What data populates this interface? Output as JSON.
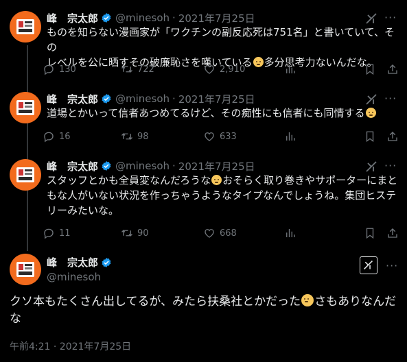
{
  "author": {
    "name": "峰　宗太郎",
    "handle": "@minesoh"
  },
  "replies": [
    {
      "date": "2021年7月25日",
      "lines": [
        "ものを知らない漫画家が「ワクチンの副反応死は751名」と書いていて、その",
        "レベルを公に晒すその破廉恥さを嘆いている|多分思考力ないんだな。"
      ],
      "stats": {
        "replies": "130",
        "retweets": "722",
        "likes": "2,910"
      }
    },
    {
      "date": "2021年7月25日",
      "lines": [
        "道場とかいって信者あつめてるけど、その痴性にも信者にも同情する|"
      ],
      "stats": {
        "replies": "16",
        "retweets": "98",
        "likes": "633"
      }
    },
    {
      "date": "2021年7月25日",
      "lines": [
        "スタッフとかも全員変なんだろうな|おそらく取り巻きやサポーターにまと",
        "もな人がいない状況を作っちゃうようなタイプなんでしょうね。集団ヒステ",
        "リーみたいな。"
      ],
      "stats": {
        "replies": "11",
        "retweets": "90",
        "likes": "668"
      }
    }
  ],
  "main": {
    "line1": "クソ本もたくさん出してるが、みたら扶桑社とかだった",
    "line1b": "さもありなんだ",
    "line2": "な",
    "timestamp": "午前4:21 · 2021年7月25日"
  },
  "ui": {
    "separator": "·",
    "more": "···",
    "colors": {
      "background": "#000000",
      "text": "#e7e9ea",
      "muted": "#71767b",
      "verified": "#1d9bf0",
      "avatar": "#f26b1d"
    },
    "icons": [
      "verified-icon",
      "grok-icon",
      "more-icon",
      "reply-icon",
      "retweet-icon",
      "like-icon",
      "views-icon",
      "bookmark-icon",
      "share-icon"
    ]
  }
}
